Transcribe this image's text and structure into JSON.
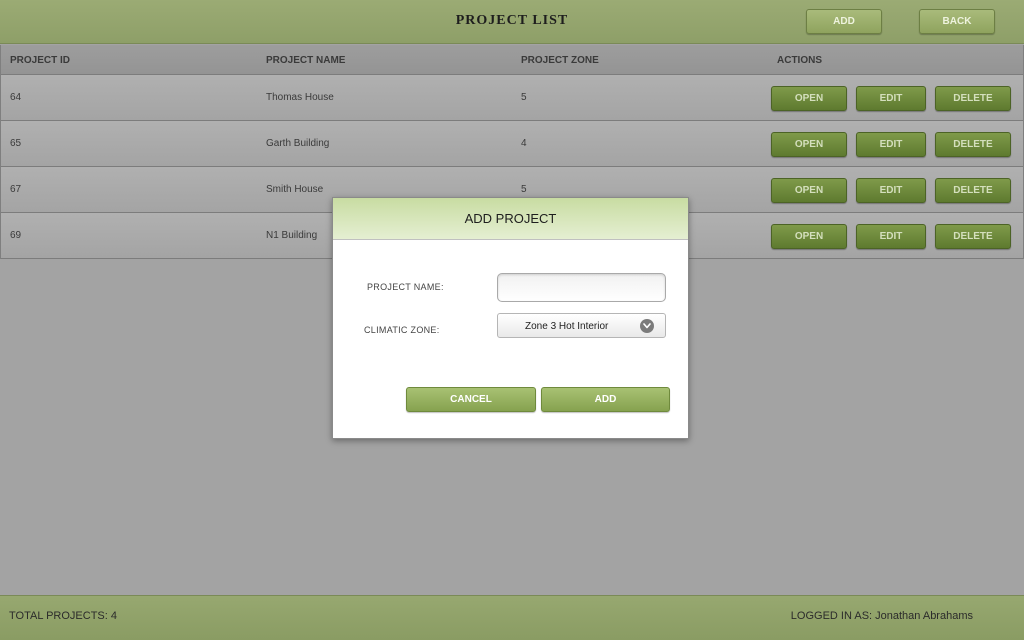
{
  "header": {
    "title": "PROJECT LIST",
    "add_label": "ADD",
    "back_label": "BACK"
  },
  "table": {
    "columns": [
      "PROJECT ID",
      "PROJECT NAME",
      "PROJECT ZONE",
      "ACTIONS"
    ],
    "rows": [
      {
        "id": "64",
        "name": "Thomas House",
        "zone": "5"
      },
      {
        "id": "65",
        "name": "Garth Building",
        "zone": "4"
      },
      {
        "id": "67",
        "name": "Smith House",
        "zone": "5"
      },
      {
        "id": "69",
        "name": "N1 Building",
        "zone": ""
      }
    ],
    "actions": {
      "open_label": "OPEN",
      "edit_label": "EDIT",
      "delete_label": "DELETE"
    }
  },
  "footer": {
    "total_projects": "TOTAL PROJECTS: 4",
    "logged_in": "LOGGED IN AS: Jonathan Abrahams"
  },
  "modal": {
    "title": "ADD PROJECT",
    "project_name_label": "PROJECT NAME:",
    "project_name_value": "",
    "climatic_zone_label": "CLIMATIC ZONE:",
    "climatic_zone_value": "Zone 3 Hot Interior",
    "cancel_label": "CANCEL",
    "add_label": "ADD"
  },
  "icons": {
    "dropdown": "chevron-down-icon"
  }
}
